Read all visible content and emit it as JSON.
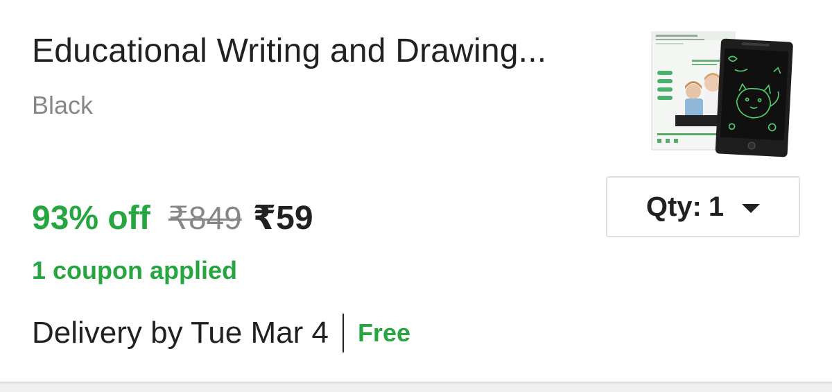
{
  "product": {
    "title": "Educational Writing and Drawing...",
    "variant": "Black",
    "thumbnail_icon": "lcd-writing-tablet-thumbnail"
  },
  "pricing": {
    "discount": "93% off",
    "mrp": "₹849",
    "final_price": "₹59",
    "coupon_text": "1 coupon applied"
  },
  "quantity": {
    "label": "Qty:",
    "value": "1"
  },
  "delivery": {
    "text": "Delivery by Tue Mar 4",
    "charge": "Free"
  },
  "colors": {
    "green": "#26a541",
    "primary_text": "#212121",
    "secondary_text": "#878787",
    "border": "#e0e0e0"
  }
}
